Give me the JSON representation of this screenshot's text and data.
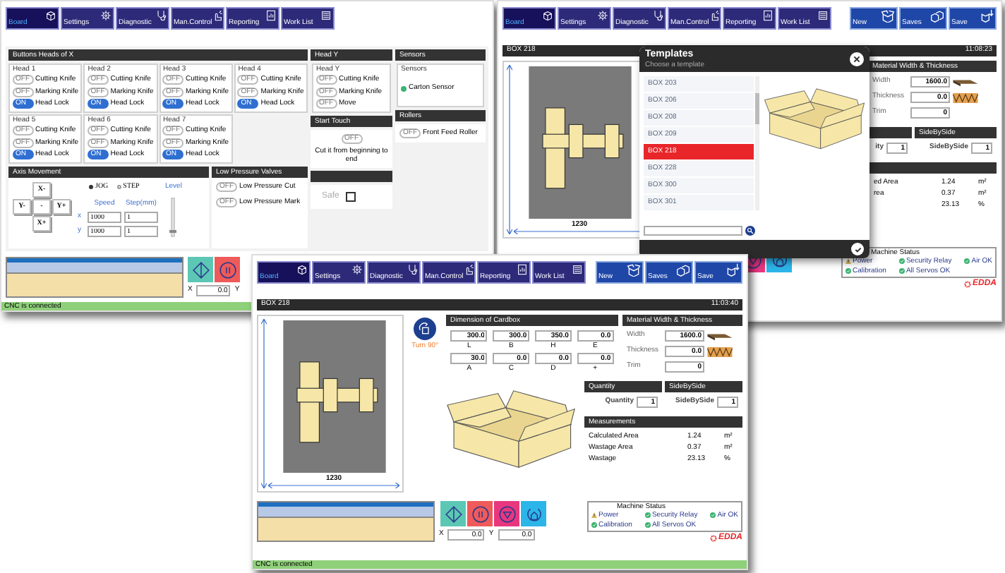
{
  "windows": [
    {
      "kind": "controls",
      "toolbar": [
        {
          "label": "Board",
          "selected": true
        },
        {
          "label": "Settings",
          "selected": false
        },
        {
          "label": "Diagnostic",
          "selected": false
        },
        {
          "label": "Man.Control",
          "selected": false
        },
        {
          "label": "Reporting",
          "selected": false
        },
        {
          "label": "Work List",
          "selected": false
        }
      ],
      "panels": {
        "heads_x": {
          "title": "Buttons Heads of X",
          "heads": [
            {
              "name": "Head 1",
              "toggles": [
                {
                  "label": "Cutting Knife",
                  "on": false,
                  "text": "OFF"
                },
                {
                  "label": "Marking Knife",
                  "on": false,
                  "text": "OFF"
                },
                {
                  "label": "Head Lock",
                  "on": true,
                  "text": "ON"
                }
              ]
            },
            {
              "name": "Head 2",
              "toggles": [
                {
                  "label": "Cutting Knife",
                  "on": false,
                  "text": "OFF"
                },
                {
                  "label": "Marking Knife",
                  "on": false,
                  "text": "OFF"
                },
                {
                  "label": "Head Lock",
                  "on": true,
                  "text": "ON"
                }
              ]
            },
            {
              "name": "Head 3",
              "toggles": [
                {
                  "label": "Cutting Knife",
                  "on": false,
                  "text": "OFF"
                },
                {
                  "label": "Marking Knife",
                  "on": false,
                  "text": "OFF"
                },
                {
                  "label": "Head Lock",
                  "on": true,
                  "text": "ON"
                }
              ]
            },
            {
              "name": "Head 4",
              "toggles": [
                {
                  "label": "Cutting Knife",
                  "on": false,
                  "text": "OFF"
                },
                {
                  "label": "Marking Knife",
                  "on": false,
                  "text": "OFF"
                },
                {
                  "label": "Head Lock",
                  "on": true,
                  "text": "ON"
                }
              ]
            },
            {
              "name": "Head 5",
              "toggles": [
                {
                  "label": "Cutting Knife",
                  "on": false,
                  "text": "OFF"
                },
                {
                  "label": "Marking Knife",
                  "on": false,
                  "text": "OFF"
                },
                {
                  "label": "Head Lock",
                  "on": true,
                  "text": "ON"
                }
              ]
            },
            {
              "name": "Head 6",
              "toggles": [
                {
                  "label": "Cutting Knife",
                  "on": false,
                  "text": "OFF"
                },
                {
                  "label": "Marking Knife",
                  "on": false,
                  "text": "OFF"
                },
                {
                  "label": "Head Lock",
                  "on": true,
                  "text": "ON"
                }
              ]
            },
            {
              "name": "Head 7",
              "toggles": [
                {
                  "label": "Cutting Knife",
                  "on": false,
                  "text": "OFF"
                },
                {
                  "label": "Marking Knife",
                  "on": false,
                  "text": "OFF"
                },
                {
                  "label": "Head Lock",
                  "on": true,
                  "text": "ON"
                }
              ]
            }
          ]
        },
        "head_y": {
          "title": "Head Y",
          "group": "Head Y",
          "toggles": [
            {
              "label": "Cutting Knife",
              "on": false,
              "text": "OFF"
            },
            {
              "label": "Marking Knife",
              "on": false,
              "text": "OFF"
            },
            {
              "label": "Move",
              "on": false,
              "text": "OFF"
            }
          ]
        },
        "sensors": {
          "title": "Sensors",
          "group": "Sensors",
          "items": [
            {
              "label": "Carton Sensor",
              "ok": true
            }
          ]
        },
        "start_touch": {
          "title": "Start Touch",
          "toggle": {
            "on": false,
            "text": "OFF"
          },
          "caption": "Cut it from beginning to end"
        },
        "rollers": {
          "title": "Rollers",
          "toggles": [
            {
              "label": "Front Feed Roller",
              "on": false,
              "text": "OFF"
            }
          ]
        },
        "axis": {
          "title": "Axis Movement",
          "buttons": [
            "X-",
            "Y-",
            "-",
            "Y+",
            "X+"
          ],
          "modes": [
            {
              "label": "JOG",
              "selected": true
            },
            {
              "label": "STEP",
              "selected": false
            }
          ],
          "level_label": "Level",
          "level": 0.05,
          "columns": [
            "Speed",
            "Step(mm)"
          ],
          "rows": [
            {
              "axis": "x",
              "speed": "1000",
              "step": "1"
            },
            {
              "axis": "y",
              "speed": "1000",
              "step": "1"
            }
          ]
        },
        "low_pressure": {
          "title": "Low Pressure Valves",
          "toggles": [
            {
              "label": "Low Pressure Cut",
              "on": false,
              "text": "OFF"
            },
            {
              "label": "Low Pressure Mark",
              "on": false,
              "text": "OFF"
            }
          ]
        },
        "safety": {
          "label": "Safe",
          "checked": false
        }
      },
      "controls": [
        {
          "kind": "start"
        },
        {
          "kind": "pause"
        }
      ],
      "x_label": "X",
      "x_value": "0.0",
      "y_label": "Y",
      "status": "CNC is connected"
    },
    {
      "kind": "designer",
      "toolbar": [
        {
          "label": "Board",
          "selected": true
        },
        {
          "label": "Settings",
          "selected": false
        },
        {
          "label": "Diagnostic",
          "selected": false
        },
        {
          "label": "Man.Control",
          "selected": false
        },
        {
          "label": "Reporting",
          "selected": false
        },
        {
          "label": "Work List",
          "selected": false
        }
      ],
      "file_buttons": [
        "New",
        "Saves",
        "Save"
      ],
      "box_name": "BOX 218",
      "time": "11:08:23",
      "drawing": {
        "width_label": "1230"
      },
      "material": {
        "title": "Material Width & Thickness",
        "rows": [
          {
            "kind": "width",
            "label": "Width",
            "value": "1600.0"
          },
          {
            "kind": "thickness",
            "label": "Thickness",
            "value": "0.0"
          },
          {
            "kind": "trim",
            "label": "Trim",
            "value": "0"
          }
        ]
      },
      "quantity": {
        "label": "ity",
        "value": "1"
      },
      "side_by_side": {
        "title": "SideBySide",
        "label": "SideBySide",
        "value": "1"
      },
      "measurements": {
        "rows": [
          {
            "label": "ed Area",
            "value": "1.24",
            "unit": "m²"
          },
          {
            "label": "rea",
            "value": "0.37",
            "unit": "m²"
          },
          {
            "label": "",
            "value": "23.13",
            "unit": "%"
          }
        ]
      },
      "controls": [
        {
          "kind": "stop"
        },
        {
          "kind": "home"
        }
      ],
      "machine_status": {
        "title": "Machine Status",
        "items": [
          {
            "label": "Power",
            "ok": false
          },
          {
            "label": "Security Relay",
            "ok": true
          },
          {
            "label": "Air OK",
            "ok": true
          },
          {
            "label": "Calibration",
            "ok": true
          },
          {
            "label": "All Servos OK",
            "ok": true
          }
        ]
      },
      "logo": "EDDA",
      "templates": {
        "title": "Templates",
        "subtitle": "Choose a template",
        "items": [
          {
            "label": "BOX 203",
            "selected": false
          },
          {
            "label": "BOX 206",
            "selected": false
          },
          {
            "label": "BOX 208",
            "selected": false
          },
          {
            "label": "BOX 209",
            "selected": false
          },
          {
            "label": "BOX 218",
            "selected": true
          },
          {
            "label": "BOX 228",
            "selected": false
          },
          {
            "label": "BOX 300",
            "selected": false
          },
          {
            "label": "BOX 301",
            "selected": false
          }
        ]
      }
    },
    {
      "kind": "designer",
      "toolbar": [
        {
          "label": "Board",
          "selected": true
        },
        {
          "label": "Settings",
          "selected": false
        },
        {
          "label": "Diagnostic",
          "selected": false
        },
        {
          "label": "Man.Control",
          "selected": false
        },
        {
          "label": "Reporting",
          "selected": false
        },
        {
          "label": "Work List",
          "selected": false
        }
      ],
      "file_buttons": [
        "New",
        "Saves",
        "Save"
      ],
      "box_name": "BOX 218",
      "time": "11:03:40",
      "drawing": {
        "width_label": "1230"
      },
      "turn": {
        "label": "Turn 90°"
      },
      "dimensions": {
        "title": "Dimension of Cardbox",
        "fields": [
          {
            "value": "300.0",
            "label": "L"
          },
          {
            "value": "300.0",
            "label": "B"
          },
          {
            "value": "350.0",
            "label": "H"
          },
          {
            "value": "0.0",
            "label": "E"
          },
          {
            "value": "30.0",
            "label": "A"
          },
          {
            "value": "0.0",
            "label": "C"
          },
          {
            "value": "0.0",
            "label": "D"
          },
          {
            "value": "0.0",
            "label": "+"
          }
        ]
      },
      "material": {
        "title": "Material Width & Thickness",
        "rows": [
          {
            "kind": "width",
            "label": "Width",
            "value": "1600.0"
          },
          {
            "kind": "thickness",
            "label": "Thickness",
            "value": "0.0"
          },
          {
            "kind": "trim",
            "label": "Trim",
            "value": "0"
          }
        ]
      },
      "quantity": {
        "title": "Quantity",
        "label": "Quantity",
        "value": "1"
      },
      "side_by_side": {
        "title": "SideBySide",
        "label": "SideBySide",
        "value": "1"
      },
      "measurements": {
        "title": "Measurements",
        "rows": [
          {
            "label": "Calculated Area",
            "value": "1.24",
            "unit": "m²"
          },
          {
            "label": "Wastage Area",
            "value": "0.37",
            "unit": "m²"
          },
          {
            "label": "Wastage",
            "value": "23.13",
            "unit": "%"
          }
        ]
      },
      "controls": [
        {
          "kind": "start"
        },
        {
          "kind": "pause"
        },
        {
          "kind": "stop"
        },
        {
          "kind": "home"
        }
      ],
      "x_label": "X",
      "x_value": "0.0",
      "y_label": "Y",
      "y_value": "0.0",
      "machine_status": {
        "title": "Machine Status",
        "items": [
          {
            "label": "Power",
            "ok": false
          },
          {
            "label": "Security Relay",
            "ok": true
          },
          {
            "label": "Air OK",
            "ok": true
          },
          {
            "label": "Calibration",
            "ok": true
          },
          {
            "label": "All Servos OK",
            "ok": true
          }
        ]
      },
      "logo": "EDDA",
      "status": "CNC is connected"
    }
  ]
}
